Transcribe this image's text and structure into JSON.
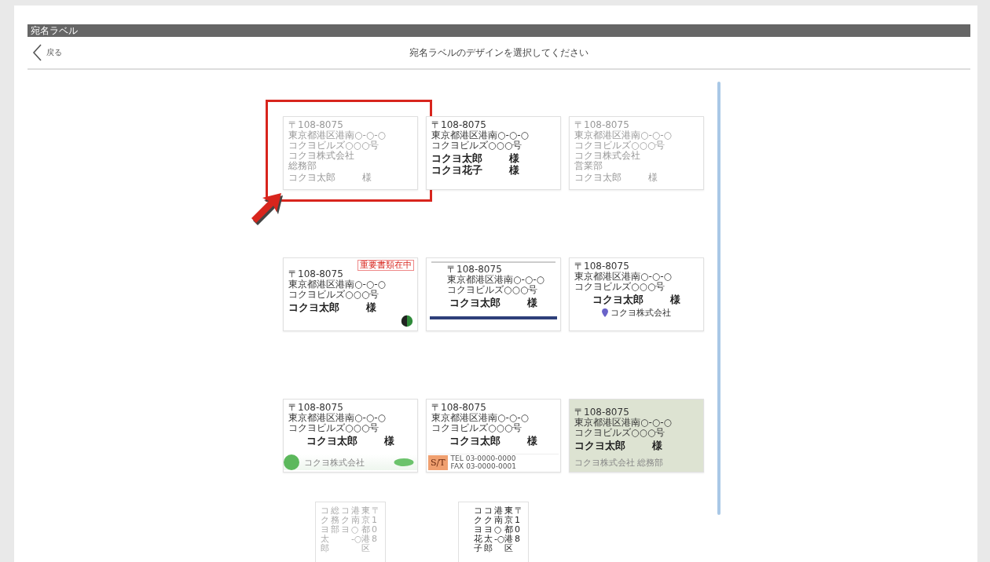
{
  "app_bar": {
    "title": "宛名ラベル"
  },
  "nav": {
    "back": "戻る",
    "title": "宛名ラベルのデザインを選択してください"
  },
  "designs": [
    {
      "kind": "plain",
      "selected": true,
      "greyed": true,
      "address": [
        "〒108-8075",
        "東京都港区港南○-○-○",
        "コクヨビルズ○○○号"
      ],
      "org": [
        "コクヨ株式会社",
        "総務部"
      ],
      "names": [
        {
          "name": "コクヨ太郎",
          "honorific": "様"
        }
      ]
    },
    {
      "kind": "plain",
      "selected": false,
      "greyed": false,
      "address": [
        "〒108-8075",
        "東京都港区港南○-○-○",
        "コクヨビルズ○○○号"
      ],
      "names": [
        {
          "name": "コクヨ太郎",
          "honorific": "様"
        },
        {
          "name": "コクヨ花子",
          "honorific": "様"
        }
      ]
    },
    {
      "kind": "plain",
      "selected": false,
      "greyed": true,
      "address": [
        "〒108-8075",
        "東京都港区港南○-○-○",
        "コクヨビルズ○○○号"
      ],
      "org": [
        "コクヨ株式会社",
        "営業部"
      ],
      "names": [
        {
          "name": "コクヨ太郎",
          "honorific": "様"
        }
      ]
    },
    {
      "kind": "tag",
      "selected": false,
      "greyed": false,
      "tag": "重要書類在中",
      "address": [
        "〒108-8075",
        "東京都港区港南○-○-○",
        "コクヨビルズ○○○号"
      ],
      "names": [
        {
          "name": "コクヨ太郎",
          "honorific": "様"
        }
      ]
    },
    {
      "kind": "band",
      "selected": false,
      "greyed": false,
      "address": [
        "〒108-8075",
        "東京都港区港南○-○-○",
        "コクヨビルズ○○○号"
      ],
      "names": [
        {
          "name": "コクヨ太郎",
          "honorific": "様"
        }
      ]
    },
    {
      "kind": "company",
      "selected": false,
      "greyed": false,
      "address": [
        "〒108-8075",
        "東京都港区港南○-○-○",
        "コクヨビルズ○○○号"
      ],
      "names": [
        {
          "name": "コクヨ太郎",
          "honorific": "様"
        }
      ],
      "company": "コクヨ株式会社"
    },
    {
      "kind": "eco",
      "selected": false,
      "greyed": false,
      "address": [
        "〒108-8075",
        "東京都港区港南○-○-○",
        "コクヨビルズ○○○号"
      ],
      "names": [
        {
          "name": "コクヨ太郎",
          "honorific": "様"
        }
      ],
      "footer": "コクヨ株式会社"
    },
    {
      "kind": "logo",
      "selected": false,
      "greyed": false,
      "address": [
        "〒108-8075",
        "東京都港区港南○-○-○",
        "コクヨビルズ○○○号"
      ],
      "names": [
        {
          "name": "コクヨ太郎",
          "honorific": "様"
        }
      ],
      "badge": "S/T",
      "contacts": [
        "TEL 03-0000-0000",
        "FAX 03-0000-0001"
      ]
    },
    {
      "kind": "tinted",
      "selected": false,
      "greyed": false,
      "address": [
        "〒108-8075",
        "東京都港区港南○-○-○",
        "コクヨビルズ○○○号"
      ],
      "names": [
        {
          "name": "コクヨ太郎",
          "honorific": "様"
        }
      ],
      "footer": "コクヨ株式会社 総務部"
    }
  ],
  "vertical_designs": [
    {
      "selected": false,
      "greyed": true,
      "columns": [
        "コクヨ太郎",
        "総務部",
        "コクヨ",
        "港南○-○",
        "東京都港区",
        "〒108"
      ]
    },
    {
      "selected": false,
      "greyed": false,
      "columns": [
        "コクヨ花子",
        "コクヨ太郎",
        "港南○-○",
        "東京都港区",
        "〒108"
      ]
    }
  ]
}
